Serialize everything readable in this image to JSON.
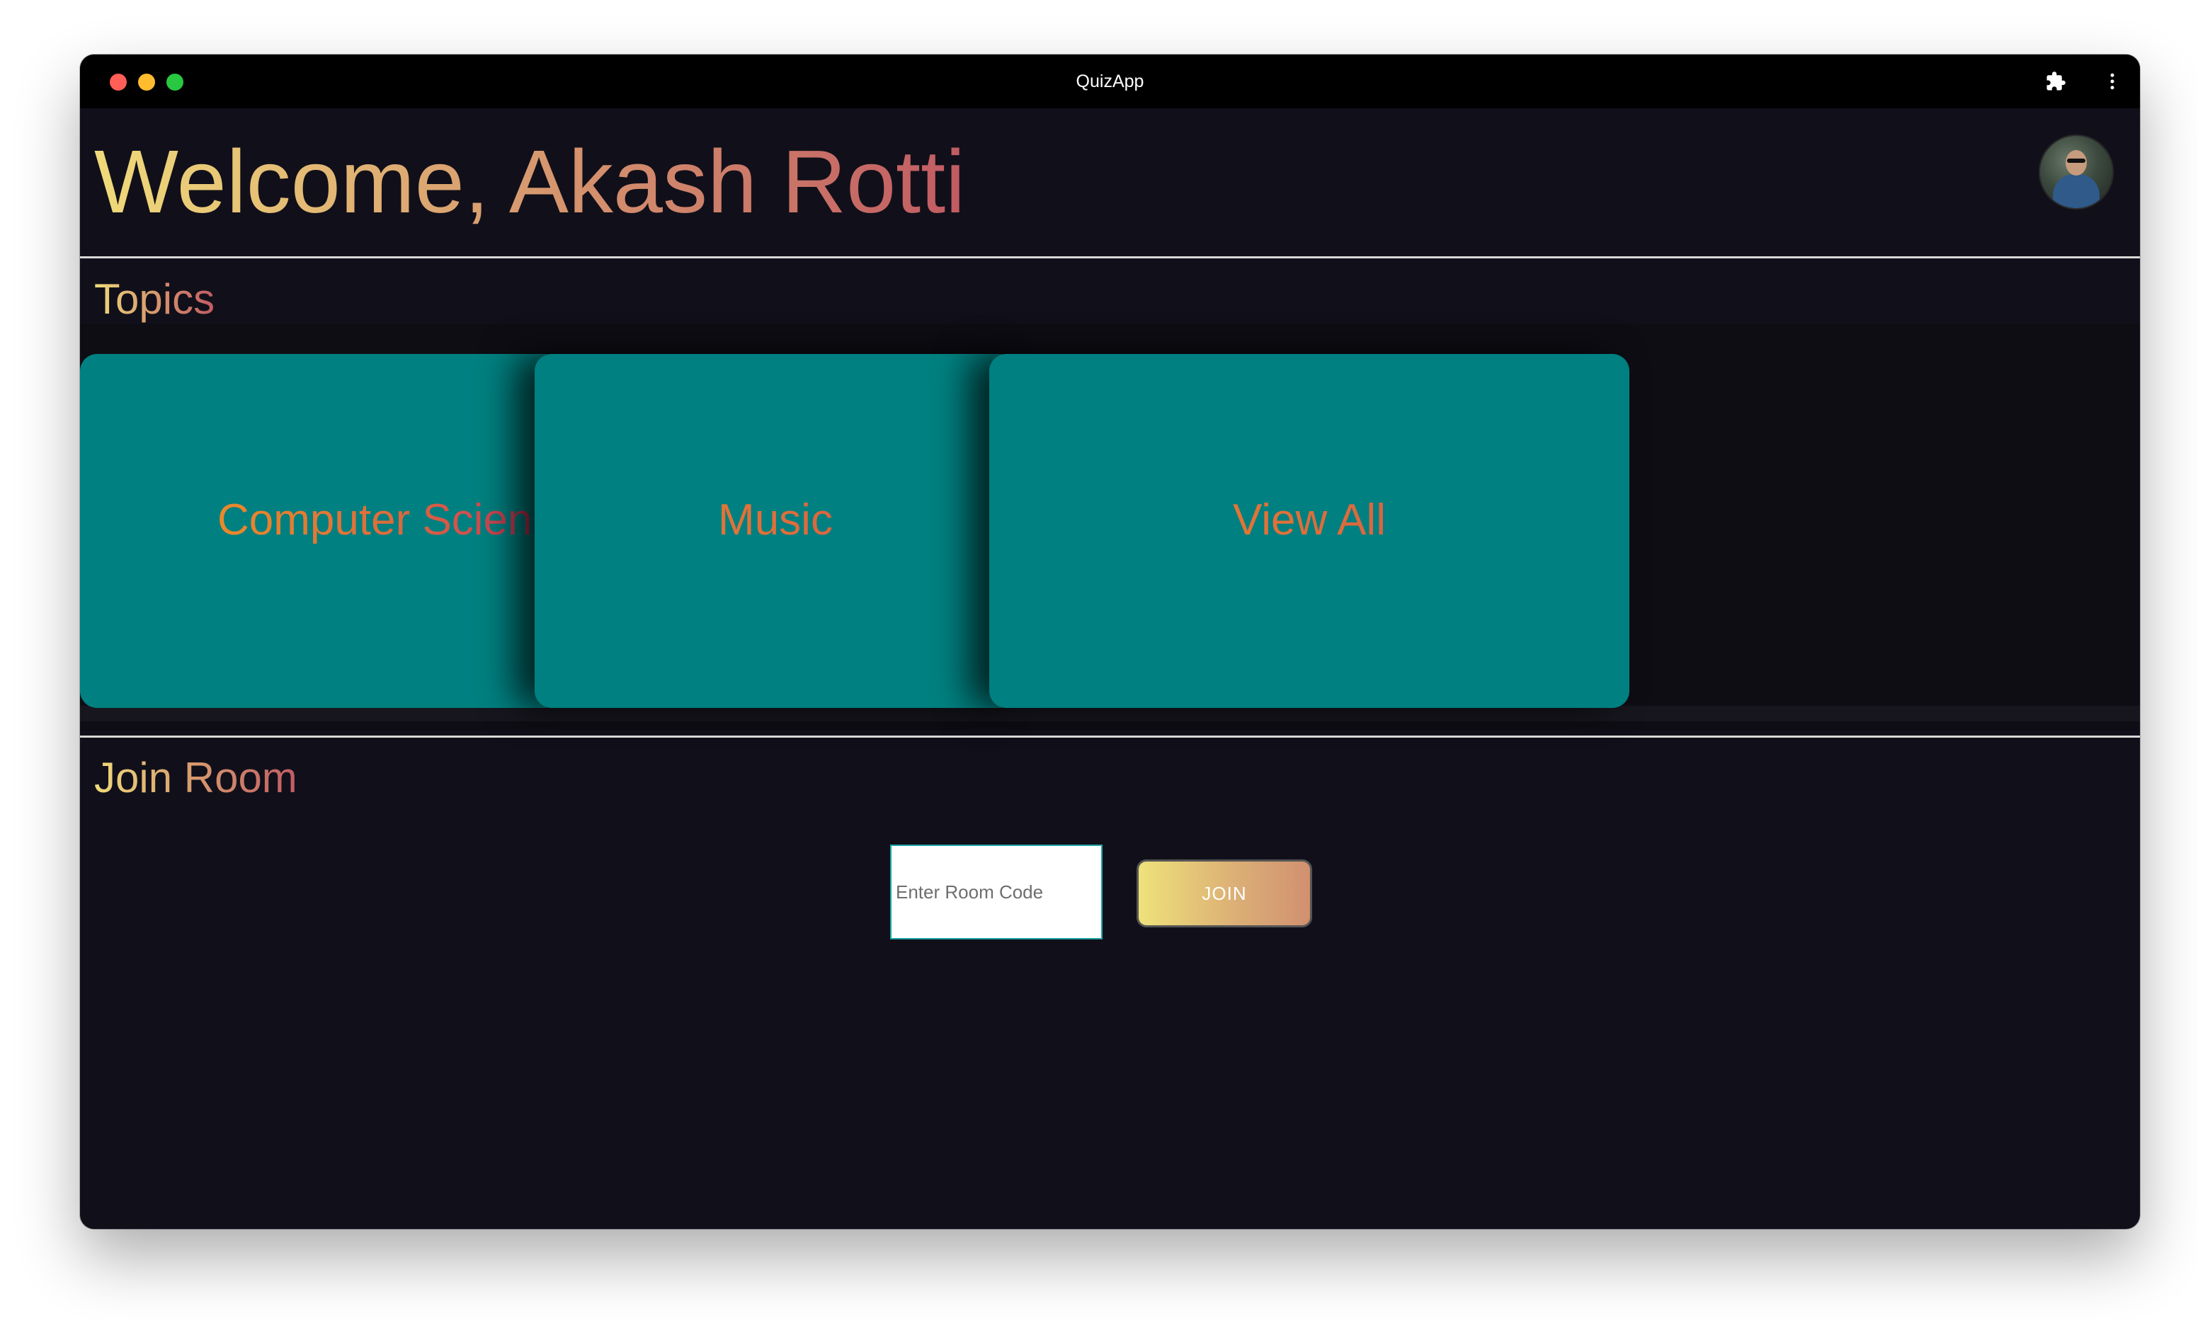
{
  "window": {
    "title": "QuizApp"
  },
  "header": {
    "welcome": "Welcome, Akash Rotti",
    "avatar_icon": "user-avatar"
  },
  "topics": {
    "heading": "Topics",
    "cards": [
      {
        "label": "Computer Scien"
      },
      {
        "label": "Music"
      },
      {
        "label": "View All"
      }
    ]
  },
  "join_room": {
    "heading": "Join Room",
    "input_placeholder": "Enter Room Code",
    "input_value": "",
    "button_label": "JOIN"
  },
  "icons": {
    "extensions": "puzzle-icon",
    "menu": "kebab-menu-icon"
  },
  "colors": {
    "background": "#11101a",
    "card": "#008080",
    "accent_start": "#f0da7a",
    "accent_end": "#c15b63"
  }
}
